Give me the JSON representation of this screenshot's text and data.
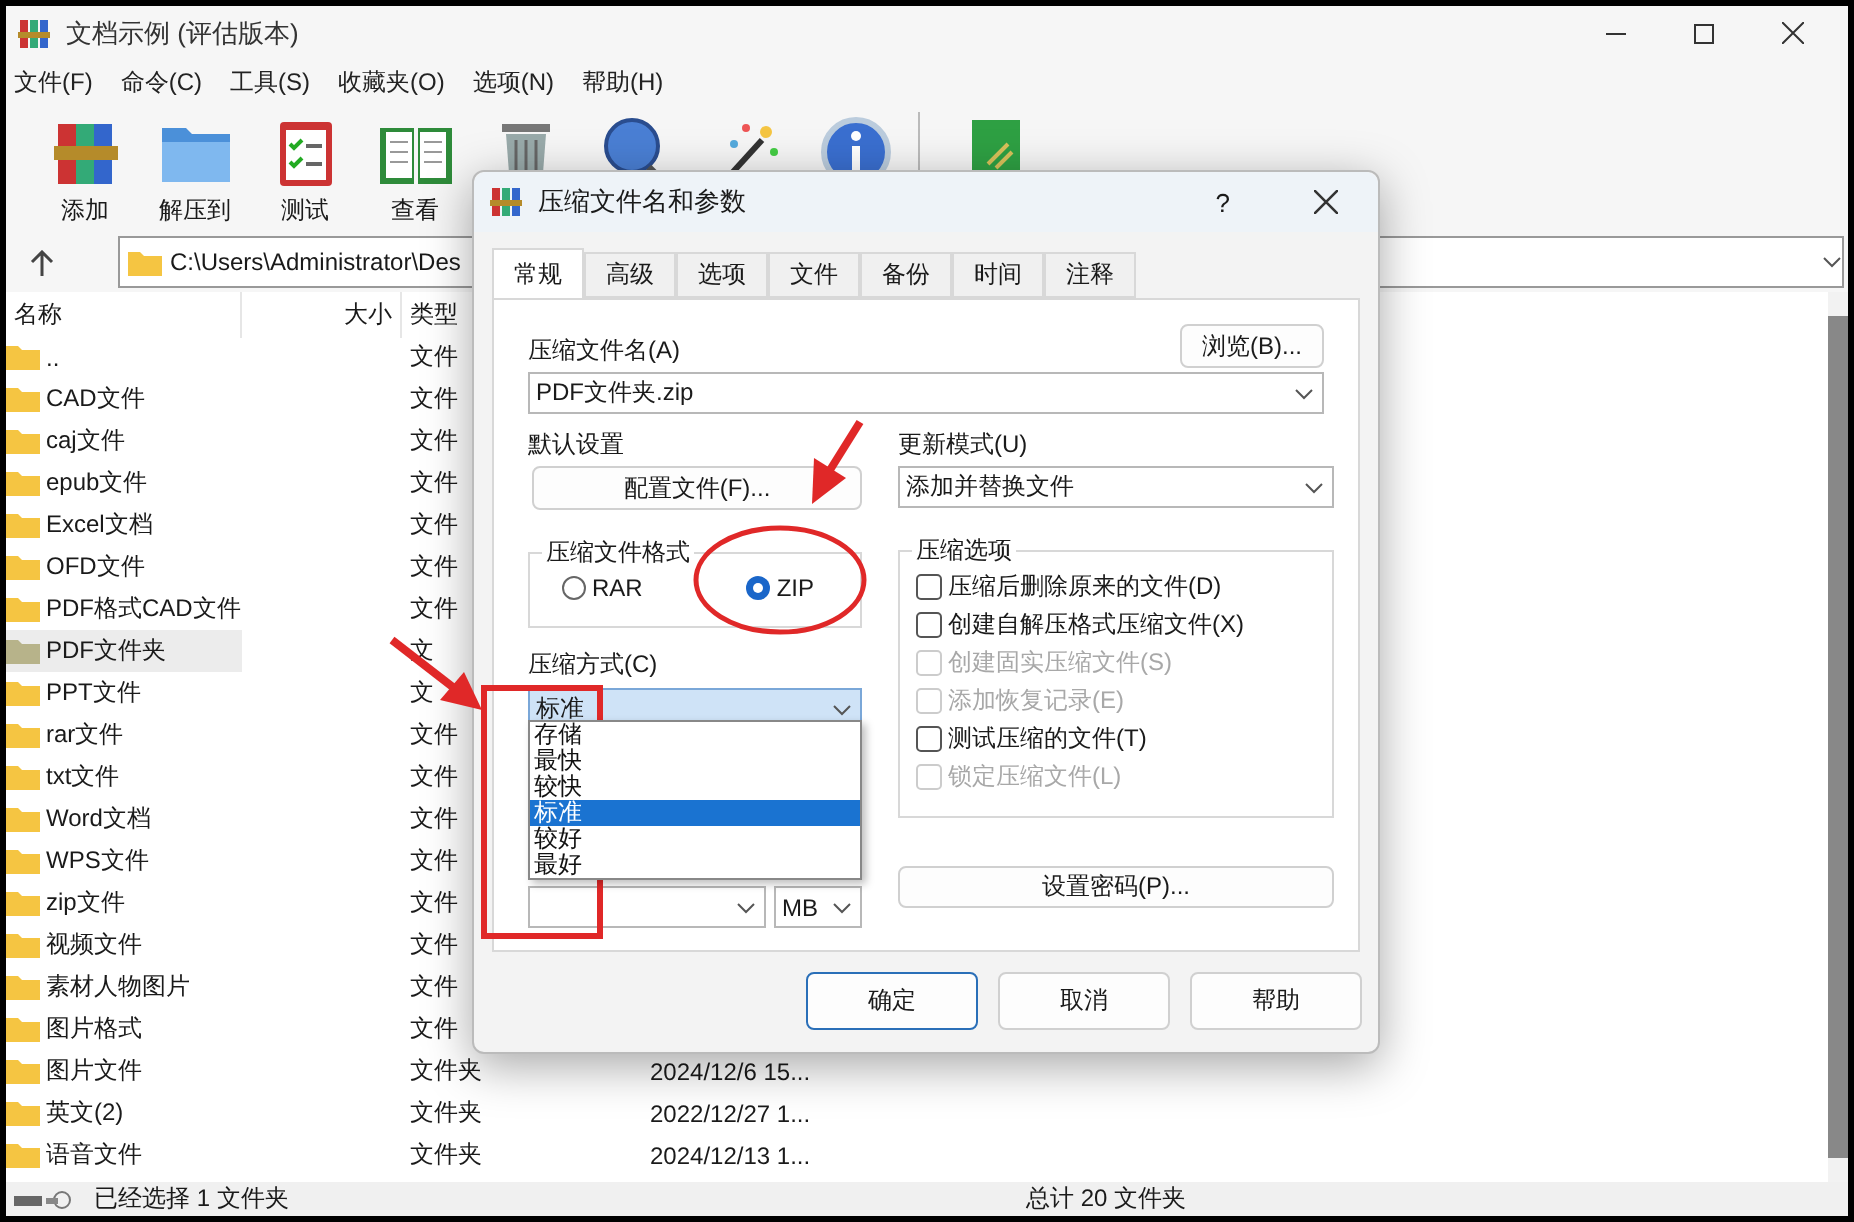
{
  "window": {
    "title": "文档示例 (评估版本)"
  },
  "menu": [
    "文件(F)",
    "命令(C)",
    "工具(S)",
    "收藏夹(O)",
    "选项(N)",
    "帮助(H)"
  ],
  "toolbar": [
    {
      "kind": "add",
      "label": "添加"
    },
    {
      "kind": "extract",
      "label": "解压到"
    },
    {
      "kind": "test",
      "label": "测试"
    },
    {
      "kind": "view",
      "label": "查看"
    },
    {
      "kind": "delete"
    },
    {
      "kind": "find"
    },
    {
      "kind": "wizard"
    },
    {
      "kind": "info"
    },
    {
      "kind": "separator"
    },
    {
      "kind": "book"
    }
  ],
  "address": {
    "path": "C:\\Users\\Administrator\\Des"
  },
  "file_list": {
    "columns": [
      "名称",
      "大小",
      "类型"
    ],
    "rows": [
      {
        "name": "..",
        "type": "文件",
        "selected": false
      },
      {
        "name": "CAD文件",
        "type": "文件",
        "selected": false
      },
      {
        "name": "caj文件",
        "type": "文件",
        "selected": false
      },
      {
        "name": "epub文件",
        "type": "文件",
        "selected": false
      },
      {
        "name": "Excel文档",
        "type": "文件",
        "selected": false
      },
      {
        "name": "OFD文件",
        "type": "文件",
        "selected": false
      },
      {
        "name": "PDF格式CAD文件",
        "type": "文件",
        "selected": false
      },
      {
        "name": "PDF文件夹",
        "type": "文",
        "selected": true
      },
      {
        "name": "PPT文件",
        "type": "文",
        "selected": false
      },
      {
        "name": "rar文件",
        "type": "文件",
        "selected": false
      },
      {
        "name": "txt文件",
        "type": "文件",
        "selected": false
      },
      {
        "name": "Word文档",
        "type": "文件",
        "selected": false
      },
      {
        "name": "WPS文件",
        "type": "文件",
        "selected": false
      },
      {
        "name": "zip文件",
        "type": "文件",
        "selected": false
      },
      {
        "name": "视频文件",
        "type": "文件",
        "selected": false
      },
      {
        "name": "素材人物图片",
        "type": "文件",
        "selected": false
      },
      {
        "name": "图片格式",
        "type": "文件",
        "selected": false
      },
      {
        "name": "图片文件",
        "type": "文件夹",
        "modified": "2024/12/6 15...",
        "selected": false
      },
      {
        "name": "英文(2)",
        "type": "文件夹",
        "modified": "2022/12/27 1...",
        "selected": false
      },
      {
        "name": "语音文件",
        "type": "文件夹",
        "modified": "2024/12/13 1...",
        "selected": false
      }
    ]
  },
  "status_bar": {
    "left": "已经选择 1 文件夹",
    "right": "总计 20 文件夹"
  },
  "dialog": {
    "title": "压缩文件名和参数",
    "help": "?",
    "tabs": [
      {
        "label": "常规",
        "selected": true
      },
      {
        "label": "高级",
        "selected": false
      },
      {
        "label": "选项",
        "selected": false
      },
      {
        "label": "文件",
        "selected": false
      },
      {
        "label": "备份",
        "selected": false
      },
      {
        "label": "时间",
        "selected": false
      },
      {
        "label": "注释",
        "selected": false
      }
    ],
    "archive_name_label": "压缩文件名(A)",
    "browse_button": "浏览(B)...",
    "archive_name": "PDF文件夹.zip",
    "default_settings_label": "默认设置",
    "profiles_button": "配置文件(F)...",
    "update_mode_label": "更新模式(U)",
    "update_mode": "添加并替换文件",
    "format": {
      "title": "压缩文件格式",
      "options": [
        {
          "label": "RAR",
          "selected": false
        },
        {
          "label": "ZIP",
          "selected": true
        }
      ]
    },
    "options": {
      "title": "压缩选项",
      "items": [
        {
          "label": "压缩后删除原来的文件(D)",
          "checked": false,
          "disabled": false
        },
        {
          "label": "创建自解压格式压缩文件(X)",
          "checked": false,
          "disabled": false
        },
        {
          "label": "创建固实压缩文件(S)",
          "checked": false,
          "disabled": true
        },
        {
          "label": "添加恢复记录(E)",
          "checked": false,
          "disabled": true
        },
        {
          "label": "测试压缩的文件(T)",
          "checked": false,
          "disabled": false
        },
        {
          "label": "锁定压缩文件(L)",
          "checked": false,
          "disabled": true
        }
      ]
    },
    "method_label": "压缩方式(C)",
    "method": "标准",
    "method_list": [
      {
        "label": "存储",
        "selected": false
      },
      {
        "label": "最快",
        "selected": false
      },
      {
        "label": "较快",
        "selected": false
      },
      {
        "label": "标准",
        "selected": true
      },
      {
        "label": "较好",
        "selected": false
      },
      {
        "label": "最好",
        "selected": false
      }
    ],
    "split_unit": "MB",
    "password_button": "设置密码(P)...",
    "buttons": [
      {
        "label": "确定",
        "default": true
      },
      {
        "label": "取消",
        "default": false
      },
      {
        "label": "帮助",
        "default": false
      }
    ]
  }
}
